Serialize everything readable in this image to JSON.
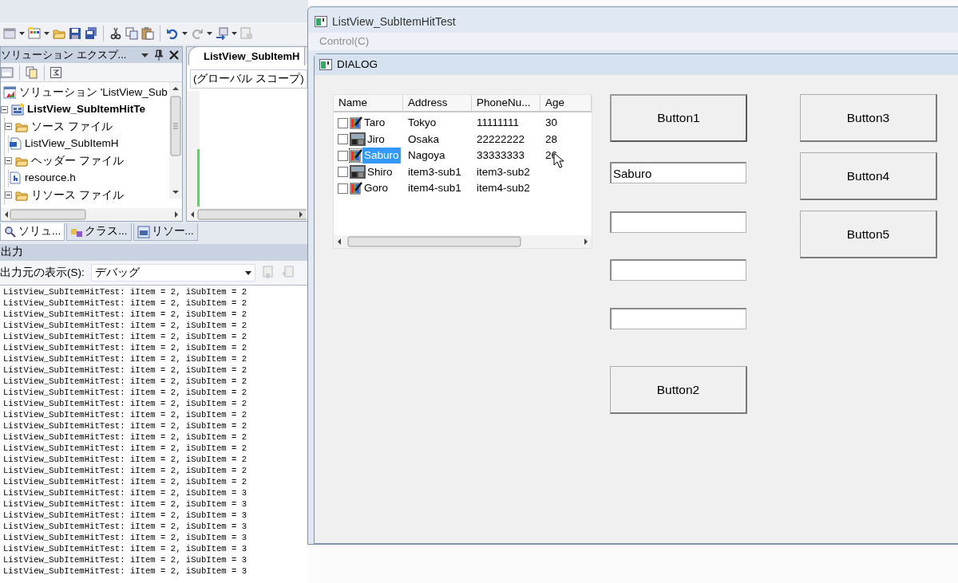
{
  "solution_explorer": {
    "title": "ソリューション エクスプ...",
    "tree": [
      {
        "label": "ソリューション 'ListView_Sub",
        "kind": "solution",
        "children": [
          {
            "label": "ListView_SubItemHitTe",
            "kind": "project",
            "expanded": true,
            "children": [
              {
                "label": "ソース ファイル",
                "kind": "folder",
                "expanded": true,
                "children": [
                  {
                    "label": "ListView_SubItemH",
                    "kind": "cpp"
                  }
                ]
              },
              {
                "label": "ヘッダー ファイル",
                "kind": "folder",
                "expanded": true,
                "children": [
                  {
                    "label": "resource.h",
                    "kind": "header"
                  }
                ]
              },
              {
                "label": "リソース ファイル",
                "kind": "folder",
                "expanded": true
              }
            ]
          }
        ]
      }
    ],
    "tabs": [
      {
        "label": "ソリュ...",
        "selected": true
      },
      {
        "label": "クラス...",
        "selected": false
      },
      {
        "label": "リソー...",
        "selected": false
      }
    ]
  },
  "editor": {
    "tab": "ListView_SubItemH",
    "scope": "(グローバル スコープ)"
  },
  "output": {
    "title": "出力",
    "source_label": "出力元の表示(S):",
    "source": "デバッグ",
    "lines": [
      "ListView_SubItemHitTest: iItem = 2, iSubItem = 2",
      "ListView_SubItemHitTest: iItem = 2, iSubItem = 2",
      "ListView_SubItemHitTest: iItem = 2, iSubItem = 2",
      "ListView_SubItemHitTest: iItem = 2, iSubItem = 2",
      "ListView_SubItemHitTest: iItem = 2, iSubItem = 2",
      "ListView_SubItemHitTest: iItem = 2, iSubItem = 2",
      "ListView_SubItemHitTest: iItem = 2, iSubItem = 2",
      "ListView_SubItemHitTest: iItem = 2, iSubItem = 2",
      "ListView_SubItemHitTest: iItem = 2, iSubItem = 2",
      "ListView_SubItemHitTest: iItem = 2, iSubItem = 2",
      "ListView_SubItemHitTest: iItem = 2, iSubItem = 2",
      "ListView_SubItemHitTest: iItem = 2, iSubItem = 2",
      "ListView_SubItemHitTest: iItem = 2, iSubItem = 2",
      "ListView_SubItemHitTest: iItem = 2, iSubItem = 2",
      "ListView_SubItemHitTest: iItem = 2, iSubItem = 2",
      "ListView_SubItemHitTest: iItem = 2, iSubItem = 2",
      "ListView_SubItemHitTest: iItem = 2, iSubItem = 2",
      "ListView_SubItemHitTest: iItem = 2, iSubItem = 2",
      "ListView_SubItemHitTest: iItem = 2, iSubItem = 3",
      "ListView_SubItemHitTest: iItem = 2, iSubItem = 3",
      "ListView_SubItemHitTest: iItem = 2, iSubItem = 3",
      "ListView_SubItemHitTest: iItem = 2, iSubItem = 3",
      "ListView_SubItemHitTest: iItem = 2, iSubItem = 3",
      "ListView_SubItemHitTest: iItem = 2, iSubItem = 3",
      "ListView_SubItemHitTest: iItem = 2, iSubItem = 3",
      "ListView_SubItemHitTest: iItem = 2, iSubItem = 3"
    ]
  },
  "app_window": {
    "title": "ListView_SubItemHitTest",
    "menu": [
      {
        "label": "Control(C)",
        "disabled": true
      }
    ],
    "dialog": {
      "title": "DIALOG",
      "list_view": {
        "columns": [
          "Name",
          "Address",
          "PhoneNu...",
          "Age"
        ],
        "rows": [
          {
            "cells": [
              "Taro",
              "Tokyo",
              "11111111",
              "30"
            ],
            "kind": "pencil",
            "checked": false,
            "selected": false
          },
          {
            "cells": [
              "Jiro",
              "Osaka",
              "22222222",
              "28"
            ],
            "kind": "photo",
            "checked": false,
            "selected": false
          },
          {
            "cells": [
              "Saburo",
              "Nagoya",
              "33333333",
              "26"
            ],
            "kind": "pencil",
            "checked": false,
            "selected": true
          },
          {
            "cells": [
              "Shiro",
              "item3-sub1",
              "item3-sub2"
            ],
            "kind": "photo",
            "checked": false,
            "selected": false
          },
          {
            "cells": [
              "Goro",
              "item4-sub1",
              "item4-sub2"
            ],
            "kind": "pencil",
            "checked": false,
            "selected": false
          }
        ]
      },
      "button_1": {
        "label": "Button1",
        "default": true
      },
      "edit_boxes": [
        {
          "filled": true,
          "value": "Saburo"
        },
        {
          "filled": false
        },
        {
          "filled": false
        },
        {
          "filled": false
        }
      ],
      "button_2": {
        "label": "Button2",
        "default": false
      },
      "right_buttons": [
        {
          "label": "Button3",
          "default": false
        },
        {
          "label": "Button4",
          "default": false
        },
        {
          "label": "Button5",
          "default": false
        }
      ]
    }
  }
}
